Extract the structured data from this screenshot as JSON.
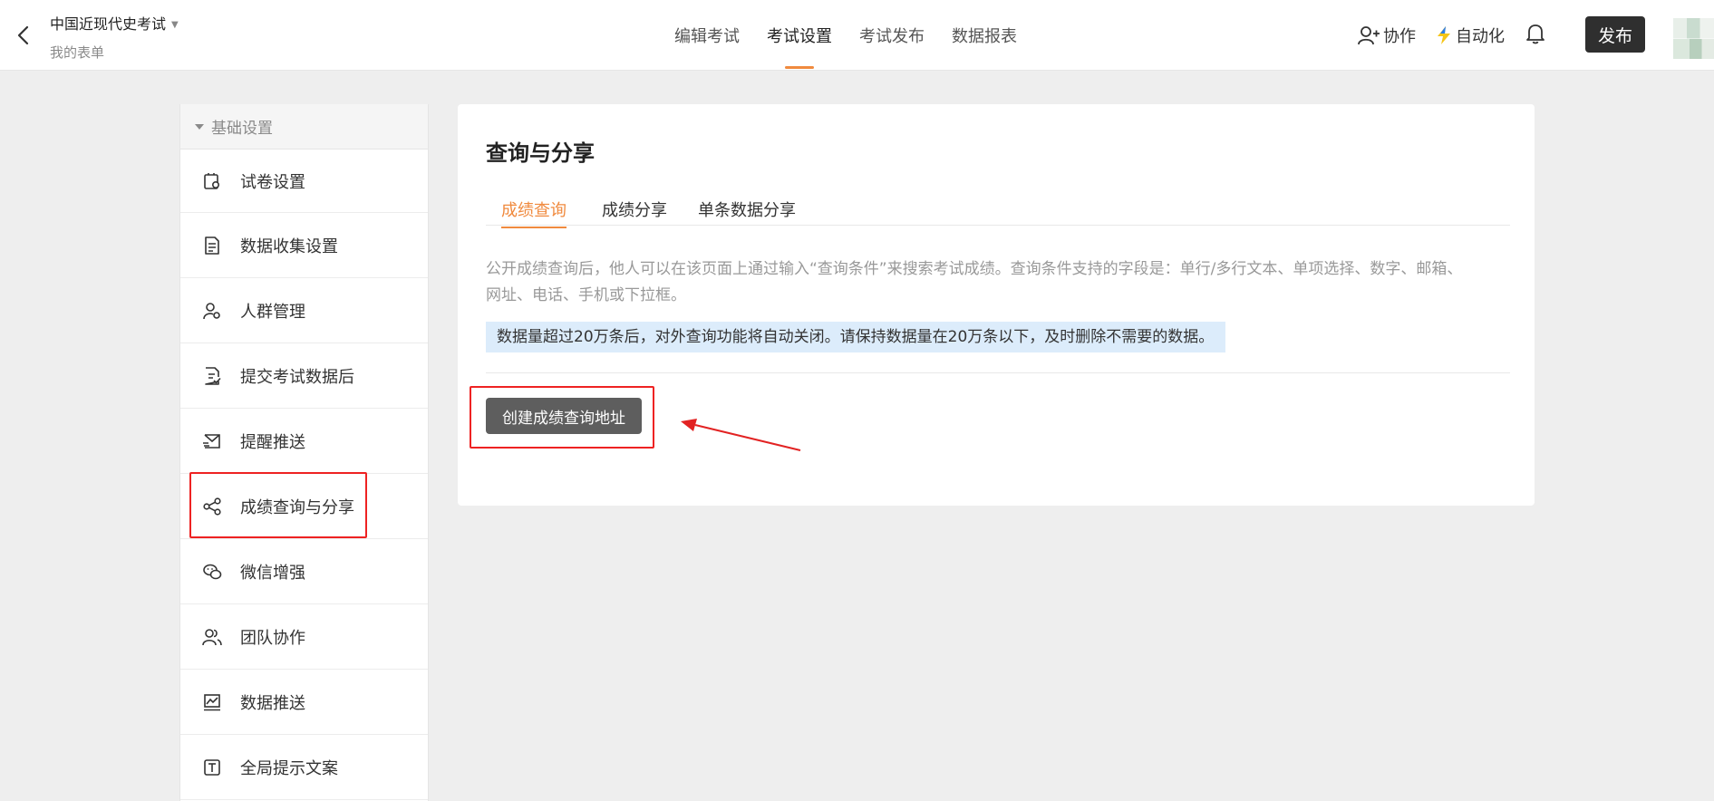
{
  "header": {
    "title": "中国近现代史考试",
    "subtitle": "我的表单",
    "tabs": [
      {
        "label": "编辑考试"
      },
      {
        "label": "考试设置"
      },
      {
        "label": "考试发布"
      },
      {
        "label": "数据报表"
      }
    ],
    "active_tab": "考试设置",
    "collab_label": "协作",
    "automation_label": "自动化",
    "publish_label": "发布",
    "accent_color": "#f08a3e"
  },
  "sidebar": {
    "section_label": "基础设置",
    "items": [
      {
        "label": "试卷设置",
        "icon": "paper-settings-icon"
      },
      {
        "label": "数据收集设置",
        "icon": "document-icon"
      },
      {
        "label": "人群管理",
        "icon": "user-settings-icon"
      },
      {
        "label": "提交考试数据后",
        "icon": "document-check-icon"
      },
      {
        "label": "提醒推送",
        "icon": "send-mail-icon"
      },
      {
        "label": "成绩查询与分享",
        "icon": "share-icon"
      },
      {
        "label": "微信增强",
        "icon": "wechat-icon"
      },
      {
        "label": "团队协作",
        "icon": "team-icon"
      },
      {
        "label": "数据推送",
        "icon": "chart-push-icon"
      },
      {
        "label": "全局提示文案",
        "icon": "text-box-icon"
      }
    ],
    "highlighted_item": "成绩查询与分享"
  },
  "main": {
    "title": "查询与分享",
    "tabs": [
      {
        "label": "成绩查询"
      },
      {
        "label": "成绩分享"
      },
      {
        "label": "单条数据分享"
      }
    ],
    "active_tab": "成绩查询",
    "description_line1": "公开成绩查询后，他人可以在该页面上通过输入“查询条件”来搜索考试成绩。查询条件支持的字段是：单行/多行文本、单项选择、数字、邮箱、",
    "description_line2": "网址、电话、手机或下拉框。",
    "notice": "数据量超过20万条后，对外查询功能将自动关闭。请保持数据量在20万条以下，及时删除不需要的数据。",
    "create_button": "创建成绩查询地址",
    "annotation_color": "#e22222"
  }
}
